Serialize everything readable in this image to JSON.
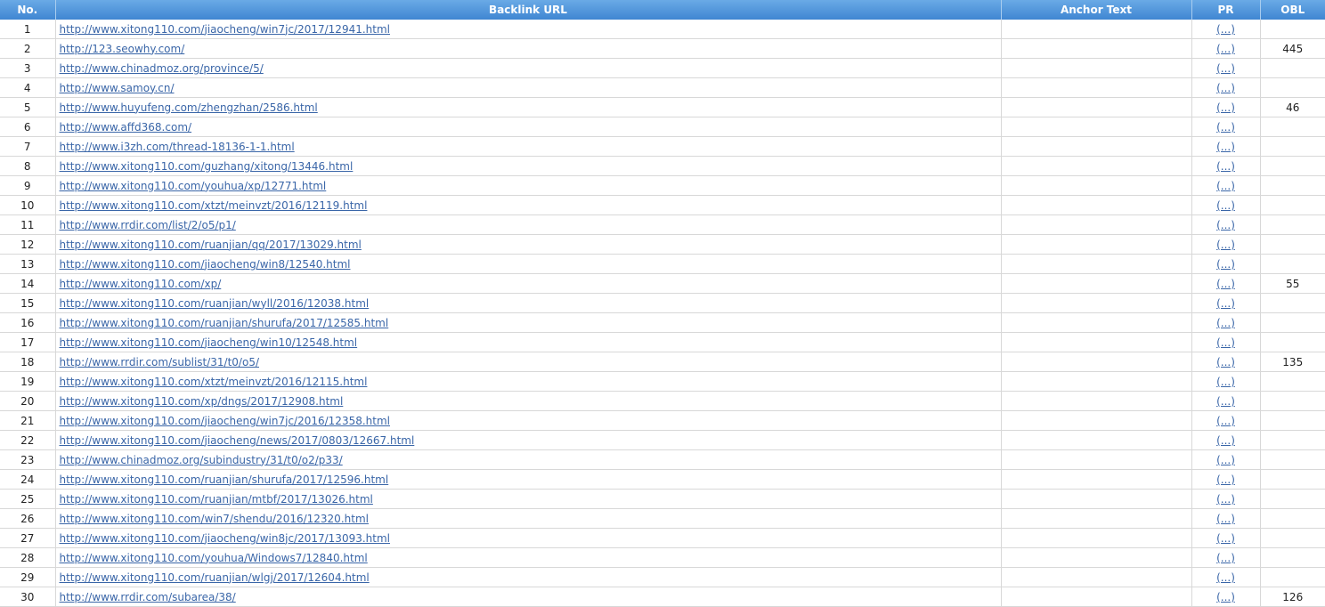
{
  "headers": {
    "no": "No.",
    "url": "Backlink URL",
    "anchor": "Anchor Text",
    "pr": "PR",
    "obl": "OBL"
  },
  "pr_link_label": "(...)",
  "rows": [
    {
      "no": "1",
      "url": "http://www.xitong110.com/jiaocheng/win7jc/2017/12941.html",
      "anchor": "",
      "obl": ""
    },
    {
      "no": "2",
      "url": "http://123.seowhy.com/",
      "anchor": "",
      "obl": "445"
    },
    {
      "no": "3",
      "url": "http://www.chinadmoz.org/province/5/",
      "anchor": "",
      "obl": ""
    },
    {
      "no": "4",
      "url": "http://www.samoy.cn/",
      "anchor": "",
      "obl": ""
    },
    {
      "no": "5",
      "url": "http://www.huyufeng.com/zhengzhan/2586.html",
      "anchor": "",
      "obl": "46"
    },
    {
      "no": "6",
      "url": "http://www.affd368.com/",
      "anchor": "",
      "obl": ""
    },
    {
      "no": "7",
      "url": "http://www.i3zh.com/thread-18136-1-1.html",
      "anchor": "",
      "obl": ""
    },
    {
      "no": "8",
      "url": "http://www.xitong110.com/guzhang/xitong/13446.html",
      "anchor": "",
      "obl": ""
    },
    {
      "no": "9",
      "url": "http://www.xitong110.com/youhua/xp/12771.html",
      "anchor": "",
      "obl": ""
    },
    {
      "no": "10",
      "url": "http://www.xitong110.com/xtzt/meinvzt/2016/12119.html",
      "anchor": "",
      "obl": ""
    },
    {
      "no": "11",
      "url": "http://www.rrdir.com/list/2/o5/p1/",
      "anchor": "",
      "obl": ""
    },
    {
      "no": "12",
      "url": "http://www.xitong110.com/ruanjian/qq/2017/13029.html",
      "anchor": "",
      "obl": ""
    },
    {
      "no": "13",
      "url": "http://www.xitong110.com/jiaocheng/win8/12540.html",
      "anchor": "",
      "obl": ""
    },
    {
      "no": "14",
      "url": "http://www.xitong110.com/xp/",
      "anchor": "",
      "obl": "55"
    },
    {
      "no": "15",
      "url": "http://www.xitong110.com/ruanjian/wyll/2016/12038.html",
      "anchor": "",
      "obl": ""
    },
    {
      "no": "16",
      "url": "http://www.xitong110.com/ruanjian/shurufa/2017/12585.html",
      "anchor": "",
      "obl": ""
    },
    {
      "no": "17",
      "url": "http://www.xitong110.com/jiaocheng/win10/12548.html",
      "anchor": "",
      "obl": ""
    },
    {
      "no": "18",
      "url": "http://www.rrdir.com/sublist/31/t0/o5/",
      "anchor": "",
      "obl": "135"
    },
    {
      "no": "19",
      "url": "http://www.xitong110.com/xtzt/meinvzt/2016/12115.html",
      "anchor": "",
      "obl": ""
    },
    {
      "no": "20",
      "url": "http://www.xitong110.com/xp/dngs/2017/12908.html",
      "anchor": "",
      "obl": ""
    },
    {
      "no": "21",
      "url": "http://www.xitong110.com/jiaocheng/win7jc/2016/12358.html",
      "anchor": "",
      "obl": ""
    },
    {
      "no": "22",
      "url": "http://www.xitong110.com/jiaocheng/news/2017/0803/12667.html",
      "anchor": "",
      "obl": ""
    },
    {
      "no": "23",
      "url": "http://www.chinadmoz.org/subindustry/31/t0/o2/p33/",
      "anchor": "",
      "obl": ""
    },
    {
      "no": "24",
      "url": "http://www.xitong110.com/ruanjian/shurufa/2017/12596.html",
      "anchor": "",
      "obl": ""
    },
    {
      "no": "25",
      "url": "http://www.xitong110.com/ruanjian/mtbf/2017/13026.html",
      "anchor": "",
      "obl": ""
    },
    {
      "no": "26",
      "url": "http://www.xitong110.com/win7/shendu/2016/12320.html",
      "anchor": "",
      "obl": ""
    },
    {
      "no": "27",
      "url": "http://www.xitong110.com/jiaocheng/win8jc/2017/13093.html",
      "anchor": "",
      "obl": ""
    },
    {
      "no": "28",
      "url": "http://www.xitong110.com/youhua/Windows7/12840.html",
      "anchor": "",
      "obl": ""
    },
    {
      "no": "29",
      "url": "http://www.xitong110.com/ruanjian/wlgj/2017/12604.html",
      "anchor": "",
      "obl": ""
    },
    {
      "no": "30",
      "url": "http://www.rrdir.com/subarea/38/",
      "anchor": "",
      "obl": "126"
    }
  ]
}
